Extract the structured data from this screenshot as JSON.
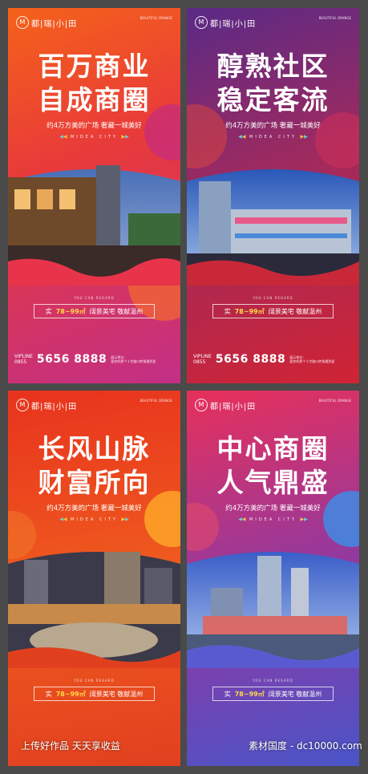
{
  "colors": {
    "accent_yellow": "#ffd94a",
    "frame": "#4a4a4a"
  },
  "brand": {
    "logo_mark": "M",
    "logo_text": "都|瑞|小|田",
    "sub": "BEAUTIFUL ORANGE"
  },
  "shared": {
    "tagline": "约4万方美的广场 奢藏一城美好",
    "midea": "MIDEA CITY",
    "small_en": "YOU CAN REGARD",
    "area_prefix": "实",
    "area_num": "78~99㎡",
    "area_text": "阔景美宅 敬献温州",
    "vipline": "VIPLINE",
    "code": "0855",
    "phone": "5656 8888",
    "addr_label": "展示地址：",
    "addr": "爱你的那个十字路口转角遇到爱"
  },
  "posters": [
    {
      "line1": "百万商业",
      "line2": "自成商圈"
    },
    {
      "line1": "醇熟社区",
      "line2": "稳定客流"
    },
    {
      "line1": "长风山脉",
      "line2": "财富所向"
    },
    {
      "line1": "中心商圈",
      "line2": "人气鼎盛"
    }
  ],
  "watermark": {
    "left": "上传好作品 天天享收益",
    "right": "素材国度 - dc10000.com"
  }
}
